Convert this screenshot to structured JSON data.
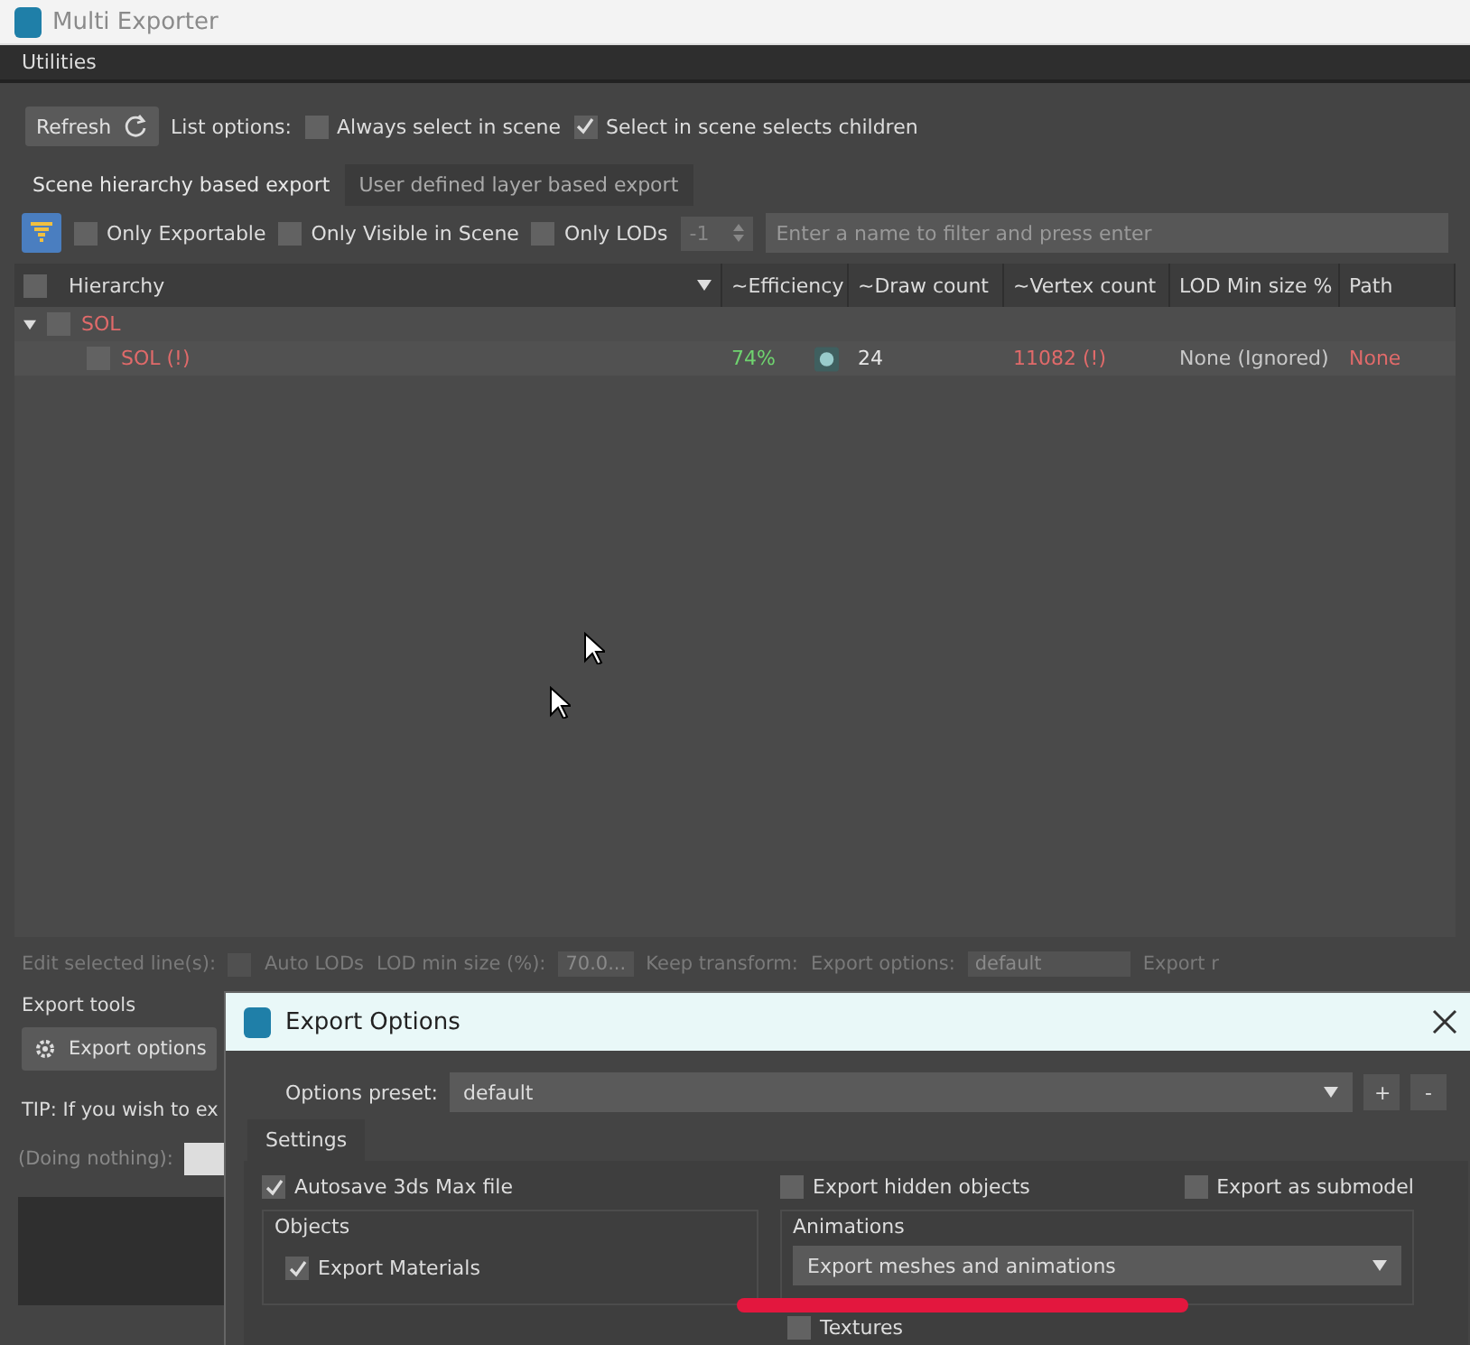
{
  "window": {
    "title": "Multi Exporter"
  },
  "menu": [
    "Utilities"
  ],
  "toolbar": {
    "refresh": "Refresh",
    "list_options": "List options:",
    "options": [
      {
        "label": "Always select in scene",
        "checked": false
      },
      {
        "label": "Select in scene selects children",
        "checked": true
      }
    ]
  },
  "tabs": [
    {
      "label": "Scene hierarchy based export",
      "selected": true
    },
    {
      "label": "User defined layer based export",
      "selected": false
    }
  ],
  "filter": {
    "options": [
      {
        "label": "Only Exportable",
        "checked": false
      },
      {
        "label": "Only Visible in Scene",
        "checked": false
      },
      {
        "label": "Only LODs",
        "checked": false
      }
    ],
    "lod_value": "-1",
    "placeholder": "Enter a name to filter and press enter"
  },
  "table": {
    "columns": [
      "Hierarchy",
      "~Efficiency",
      "~Draw count",
      "~Vertex count",
      "LOD Min size %",
      "Path"
    ],
    "rows": [
      {
        "name": "SOL",
        "expanded": true,
        "checked": false,
        "children": [
          {
            "name": "SOL (!)",
            "checked": false,
            "cells": [
              {
                "text": "74%",
                "color": "#6fd36f"
              },
              {
                "text": "24",
                "color": "#e8e8e8"
              },
              {
                "text": "11082 (!)",
                "color": "#e06a6a"
              },
              {
                "text": "None (Ignored)",
                "color": "#c8c8c8"
              },
              {
                "text": "None",
                "color": "#e06a6a"
              }
            ]
          }
        ]
      }
    ]
  },
  "edit_bar": {
    "label": "Edit selected line(s):",
    "auto_lods": "Auto LODs",
    "auto_lods_checked": false,
    "lod_label": "LOD min size (%):",
    "lod_value": "70.0...",
    "keep_transform": "Keep transform:",
    "export_options": "Export options:",
    "preset": "default",
    "cut_label": "Export r"
  },
  "export_tools": {
    "heading": "Export tools",
    "button": "Export options",
    "tip": "TIP: If you wish to ex",
    "status": "(Doing nothing):"
  },
  "dialog": {
    "title": "Export Options",
    "preset_label": "Options preset:",
    "preset": "default",
    "preset_buttons": [
      "+",
      "-"
    ],
    "tab": "Settings",
    "top_options": [
      {
        "label": "Autosave 3ds Max file",
        "checked": true
      },
      {
        "label": "Export hidden objects",
        "checked": false
      },
      {
        "label": "Export as submodel",
        "checked": false
      }
    ],
    "objects": {
      "title": "Objects",
      "options": [
        {
          "label": "Export Materials",
          "checked": true
        }
      ]
    },
    "animations": {
      "title": "Animations",
      "value": "Export meshes and animations"
    },
    "textures": {
      "label": "Textures",
      "checked": false
    }
  }
}
